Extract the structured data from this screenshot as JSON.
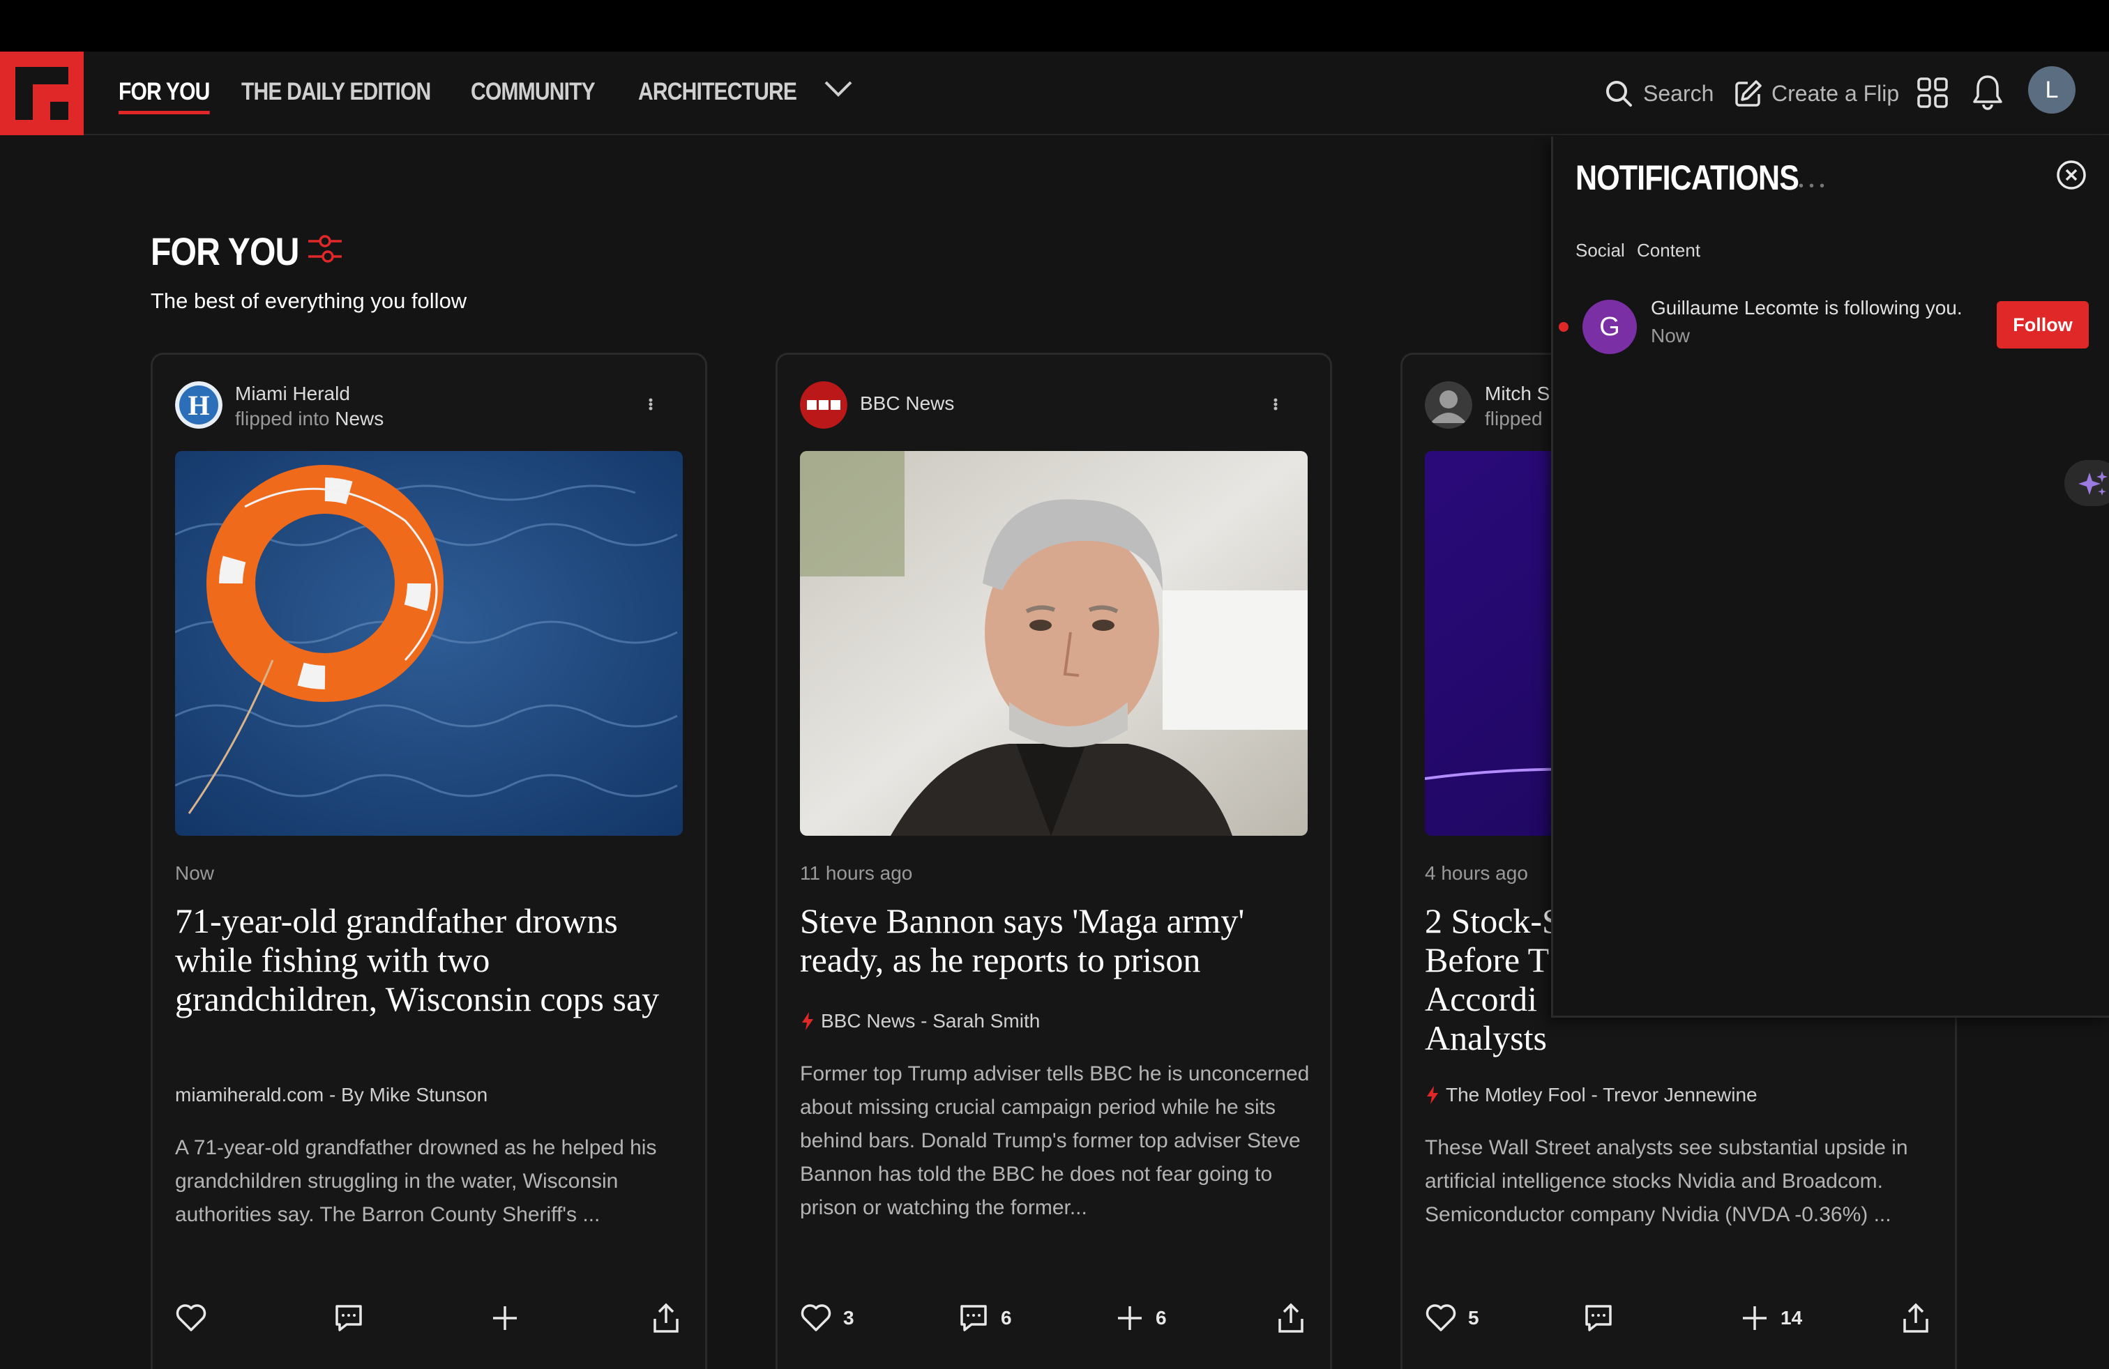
{
  "nav": {
    "tabs": [
      {
        "label": "FOR YOU",
        "active": true
      },
      {
        "label": "THE DAILY EDITION"
      },
      {
        "label": "COMMUNITY"
      },
      {
        "label": "ARCHITECTURE"
      }
    ],
    "search_label": "Search",
    "create_label": "Create a Flip",
    "avatar_initial": "L",
    "accent_color": "#e12828"
  },
  "section": {
    "title": "FOR YOU",
    "subtitle": "The best of everything you follow"
  },
  "cards": [
    {
      "source": "Miami Herald",
      "flipped_prefix": "flipped into",
      "flipped_target": "News",
      "time": "Now",
      "headline": "71-year-old grandfather drowns while fishing with two grandchildren, Wisconsin cops say",
      "byline": "miamiherald.com - By Mike Stunson",
      "excerpt": "A 71-year-old grandfather drowned as he helped his grandchildren struggling in the water, Wisconsin authorities say. The Barron County Sheriff's ...",
      "likes": "",
      "comments": "",
      "flips": ""
    },
    {
      "source": "BBC News",
      "source_logo_text": "BBC",
      "time": "11 hours ago",
      "headline": "Steve Bannon says 'Maga army' ready, as he reports to prison",
      "byline": "BBC News - Sarah Smith",
      "excerpt": "Former top Trump adviser tells BBC he is unconcerned about missing crucial campaign period while he sits behind bars. Donald Trump's former top adviser Steve Bannon has told the BBC he does not fear going to prison or watching the former...",
      "likes": "3",
      "comments": "6",
      "flips": "6"
    },
    {
      "source": "Mitch S",
      "flipped_prefix": "flipped",
      "time": "4 hours ago",
      "headline_lines": [
        "2 Stock-S",
        "Before T",
        "Accordi",
        "Analysts"
      ],
      "byline": "The Motley Fool - Trevor Jennewine",
      "excerpt": "These Wall Street analysts see substantial upside in artificial intelligence stocks Nvidia and Broadcom. Semiconductor company Nvidia (NVDA -0.36%) ...",
      "likes": "5",
      "comments": "",
      "flips": "14"
    }
  ],
  "notifications": {
    "title": "NOTIFICATIONS",
    "tabs": [
      "Social",
      "Content"
    ],
    "items": [
      {
        "avatar_initial": "G",
        "text": "Guillaume Lecomte is following you.",
        "time": "Now",
        "action_label": "Follow"
      }
    ]
  }
}
